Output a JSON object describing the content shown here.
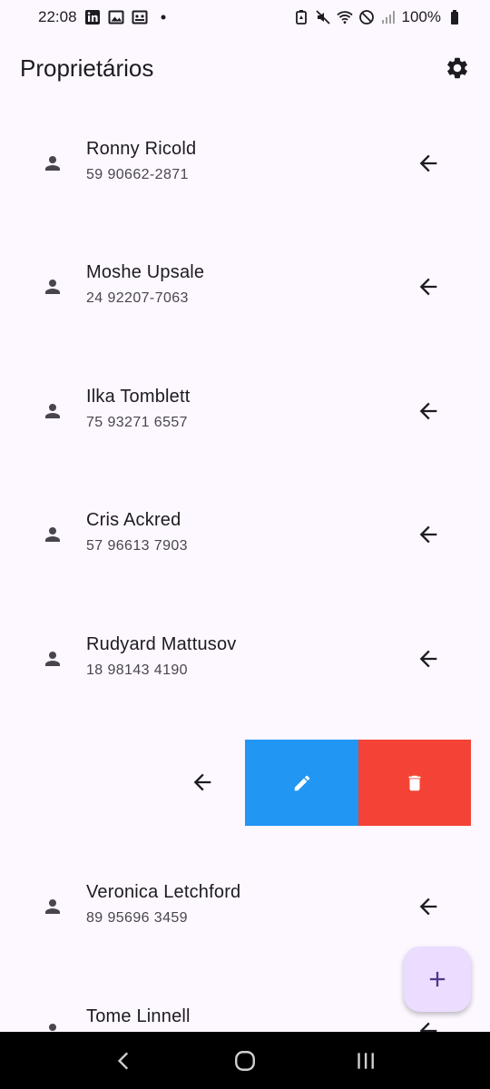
{
  "status_bar": {
    "time": "22:08",
    "battery": "100%",
    "left_icons": [
      "linkedin-icon",
      "image-icon",
      "gallery-icon",
      "dot-icon"
    ],
    "right_icons": [
      "battery-saver-icon",
      "mute-icon",
      "wifi-icon",
      "dnd-icon",
      "signal-icon",
      "battery-icon"
    ]
  },
  "app_bar": {
    "title": "Proprietários",
    "action_icon": "gear-icon"
  },
  "owners": [
    {
      "name": "Ronny Ricold",
      "phone": "59 90662-2871"
    },
    {
      "name": "Moshe Upsale",
      "phone": "24 92207-7063"
    },
    {
      "name": "Ilka Tomblett",
      "phone": "75 93271 6557"
    },
    {
      "name": "Cris Ackred",
      "phone": "57 96613 7903"
    },
    {
      "name": "Rudyard Mattusov",
      "phone": "18 98143 4190"
    },
    {
      "name": "Veronica Letchford",
      "phone": "89 95696 3459"
    },
    {
      "name": "Tome Linnell",
      "phone": ""
    }
  ],
  "swiped_row": {
    "actions": [
      {
        "icon": "edit-icon",
        "color": "#2196f3"
      },
      {
        "icon": "trash-icon",
        "color": "#f44336"
      }
    ]
  },
  "fab": {
    "icon": "plus-icon",
    "color": "#eaddff"
  },
  "colors": {
    "background": "#fdf7ff",
    "primary": "#6750a4",
    "nav_bar": "#000000"
  },
  "nav_bar": {
    "buttons": [
      "back-icon",
      "home-icon",
      "recents-icon"
    ]
  }
}
